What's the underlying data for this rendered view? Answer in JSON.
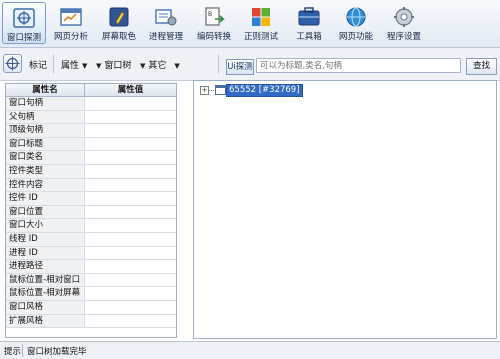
{
  "toolbar": {
    "items": [
      {
        "label": "窗口探测",
        "icon": "crosshair-window-icon"
      },
      {
        "label": "网页分析",
        "icon": "web-analysis-icon"
      },
      {
        "label": "屏幕取色",
        "icon": "color-picker-icon"
      },
      {
        "label": "进程管理",
        "icon": "process-manager-icon"
      },
      {
        "label": "编码转换",
        "icon": "encoding-convert-icon"
      },
      {
        "label": "正则测试",
        "icon": "regex-test-icon"
      },
      {
        "label": "工具箱",
        "icon": "toolbox-icon"
      },
      {
        "label": "网页功能",
        "icon": "globe-icon"
      },
      {
        "label": "程序设置",
        "icon": "settings-icon"
      }
    ]
  },
  "options": {
    "mark_label": "标记",
    "property_label": "属性",
    "window_tree_label": "窗口树",
    "other_label": "其它",
    "find_button": "Ui探测",
    "search_placeholder": "可以为标题,类名,句柄",
    "lookup_button": "查找"
  },
  "grid": {
    "headers": [
      "属性名",
      "属性值"
    ],
    "rows": [
      {
        "name": "窗口句柄",
        "value": ""
      },
      {
        "name": "父句柄",
        "value": ""
      },
      {
        "name": "顶级句柄",
        "value": ""
      },
      {
        "name": "窗口标题",
        "value": ""
      },
      {
        "name": "窗口类名",
        "value": ""
      },
      {
        "name": "控件类型",
        "value": ""
      },
      {
        "name": "控件内容",
        "value": ""
      },
      {
        "name": "控件 ID",
        "value": ""
      },
      {
        "name": "窗口位置",
        "value": ""
      },
      {
        "name": "窗口大小",
        "value": ""
      },
      {
        "name": "线程 ID",
        "value": ""
      },
      {
        "name": "进程 ID",
        "value": ""
      },
      {
        "name": "进程路径",
        "value": ""
      },
      {
        "name": "鼠标位置-相对窗口",
        "value": ""
      },
      {
        "name": "鼠标位置-相对屏幕",
        "value": ""
      },
      {
        "name": "窗口风格",
        "value": ""
      },
      {
        "name": "扩展风格",
        "value": ""
      }
    ]
  },
  "tree": {
    "toggle": "+",
    "root_label": "65552 [#32769]"
  },
  "status": {
    "label": "提示",
    "text": "窗口树加载完毕"
  },
  "colors": {
    "selection": "#316ac5",
    "toolbar_bg": "#e3eaf4",
    "border": "#9fb0c6"
  }
}
